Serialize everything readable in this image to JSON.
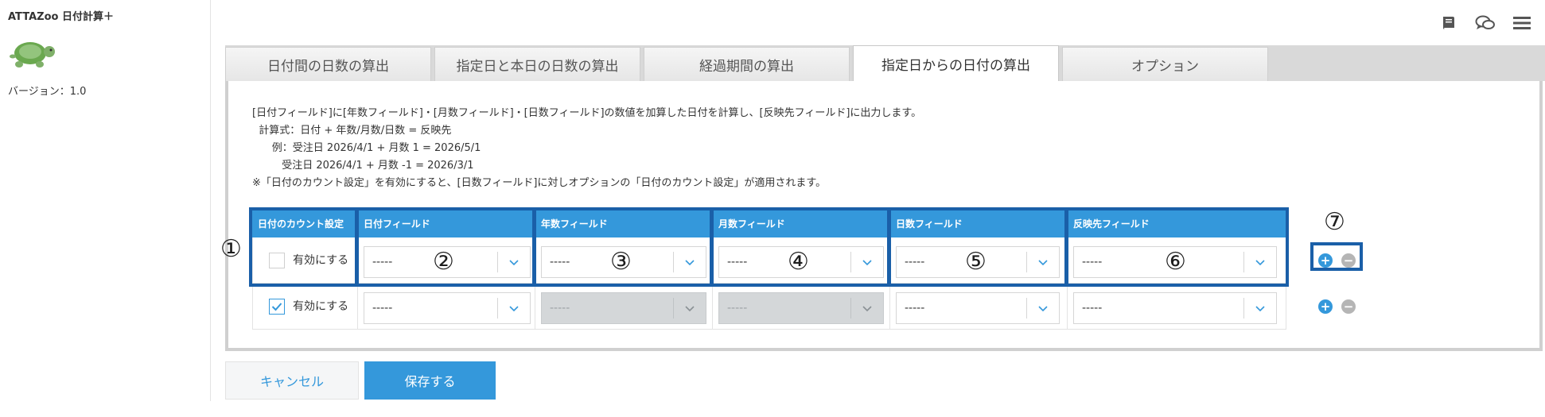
{
  "app": {
    "title": "ATTAZoo 日付計算＋",
    "version": "バージョン：1.0"
  },
  "tabs": [
    {
      "label": "日付間の日数の算出"
    },
    {
      "label": "指定日と本日の日数の算出"
    },
    {
      "label": "経過期間の算出"
    },
    {
      "label": "指定日からの日付の算出",
      "active": true
    },
    {
      "label": "オプション"
    }
  ],
  "description": {
    "line1": "[日付フィールド]に[年数フィールド]・[月数フィールド]・[日数フィールド]の数値を加算した日付を計算し、[反映先フィールド]に出力します。",
    "line2": "  計算式：日付 + 年数/月数/日数 = 反映先",
    "line3": "      例：受注日 2026/4/1 + 月数 1 = 2026/5/1",
    "line4": "         受注日 2026/4/1 + 月数 -1 = 2026/3/1",
    "line5": "※「日付のカウント設定」を有効にすると、[日数フィールド]に対しオプションの「日付のカウント設定」が適用されます。"
  },
  "table": {
    "headers": [
      "日付のカウント設定",
      "日付フィールド",
      "年数フィールド",
      "月数フィールド",
      "日数フィールド",
      "反映先フィールド"
    ],
    "checkbox_label": "有効にする",
    "rows": [
      {
        "checked": false,
        "date": "-----",
        "years": "-----",
        "months": "-----",
        "days": "-----",
        "target": "-----",
        "years_disabled": false,
        "months_disabled": false
      },
      {
        "checked": true,
        "date": "-----",
        "years": "-----",
        "months": "-----",
        "days": "-----",
        "target": "-----",
        "years_disabled": true,
        "months_disabled": true
      }
    ]
  },
  "annotations": [
    "①",
    "②",
    "③",
    "④",
    "⑤",
    "⑥",
    "⑦"
  ],
  "buttons": {
    "cancel": "キャンセル",
    "save": "保存する"
  },
  "icons": {
    "manual": "book-icon",
    "support": "chat-bubbles-icon",
    "menu": "hamburger-menu-icon",
    "logo": "turtle-icon"
  },
  "colors": {
    "accent": "#3498db",
    "annotation_frame": "#1a5fa8",
    "disabled": "#d4d7d9"
  }
}
